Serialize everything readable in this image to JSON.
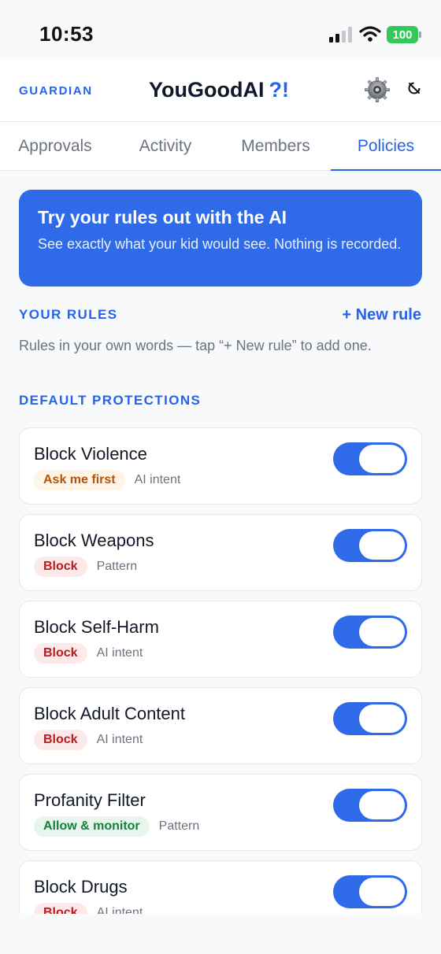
{
  "status": {
    "time": "10:53",
    "battery": "100",
    "signal_icon": "cellular-signal-icon",
    "wifi_icon": "wifi-icon"
  },
  "header": {
    "role": "GUARDIAN",
    "title": "YouGoodAI",
    "title_accent": "?!",
    "settings_icon": "gear-icon",
    "reset_icon": "reset-icon"
  },
  "tabs": [
    {
      "label": "Approvals",
      "active": false
    },
    {
      "label": "Activity",
      "active": false
    },
    {
      "label": "Members",
      "active": false
    },
    {
      "label": "Policies",
      "active": true
    }
  ],
  "banner": {
    "title": "Try your rules out with the AI",
    "subtitle": "See exactly what your kid would see. Nothing is recorded."
  },
  "your_rules": {
    "title": "YOUR RULES",
    "new_rule": "+ New rule",
    "hint": "Rules in your own words — tap “+ New rule” to add one."
  },
  "default_protections": {
    "title": "DEFAULT PROTECTIONS",
    "items": [
      {
        "name": "Block Violence",
        "action": "Ask me first",
        "action_type": "ask",
        "kind": "AI intent",
        "enabled": true
      },
      {
        "name": "Block Weapons",
        "action": "Block",
        "action_type": "block",
        "kind": "Pattern",
        "enabled": true
      },
      {
        "name": "Block Self-Harm",
        "action": "Block",
        "action_type": "block",
        "kind": "AI intent",
        "enabled": true
      },
      {
        "name": "Block Adult Content",
        "action": "Block",
        "action_type": "block",
        "kind": "AI intent",
        "enabled": true
      },
      {
        "name": "Profanity Filter",
        "action": "Allow & monitor",
        "action_type": "allow",
        "kind": "Pattern",
        "enabled": true
      },
      {
        "name": "Block Drugs",
        "action": "Block",
        "action_type": "block",
        "kind": "AI intent",
        "enabled": true
      }
    ]
  },
  "colors": {
    "accent": "#2563eb",
    "banner": "#2f6be8",
    "ask": "#b45309",
    "block": "#b91c1c",
    "allow": "#15803d"
  }
}
